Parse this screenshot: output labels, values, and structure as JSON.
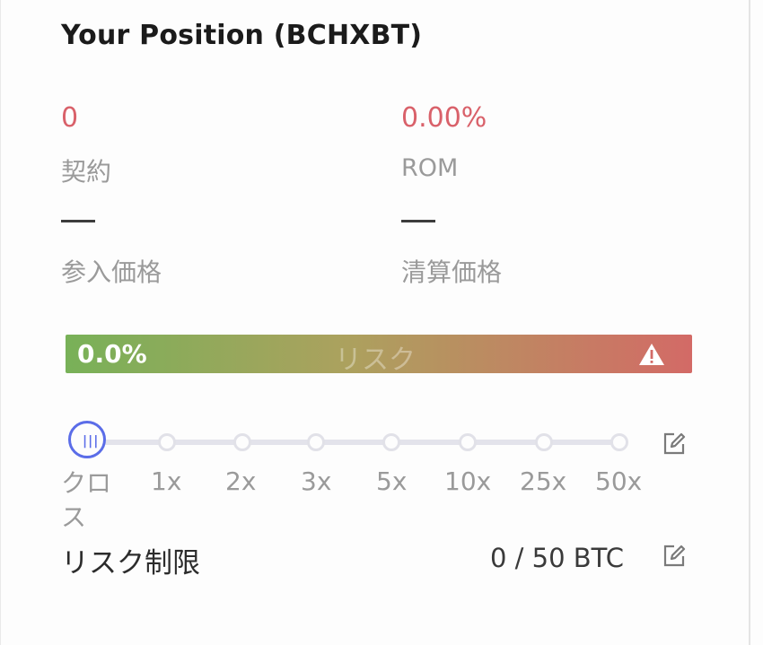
{
  "panel": {
    "title": "Your Position (BCHXBT)"
  },
  "stats": {
    "contracts_value": "0",
    "contracts_label": "契約",
    "rom_value": "0.00%",
    "rom_label": "ROM",
    "entry_price_value": "—",
    "entry_price_label": "参入価格",
    "liq_price_value": "—",
    "liq_price_label": "清算価格"
  },
  "risk": {
    "percent_label": "0.0%",
    "percent_value": 0.0,
    "center_label": "リスク",
    "icon": "warning-icon"
  },
  "leverage": {
    "selected": "クロス",
    "options": [
      "クロス",
      "1x",
      "2x",
      "3x",
      "5x",
      "10x",
      "25x",
      "50x"
    ],
    "edit_icon": "edit-icon"
  },
  "risk_limit": {
    "label": "リスク制限",
    "value": "0 / 50 BTC",
    "edit_icon": "edit-icon"
  },
  "colors": {
    "accent": "#5b6de8",
    "negative": "#d9616a",
    "risk_low": "#78b158",
    "risk_high": "#d36a66"
  }
}
